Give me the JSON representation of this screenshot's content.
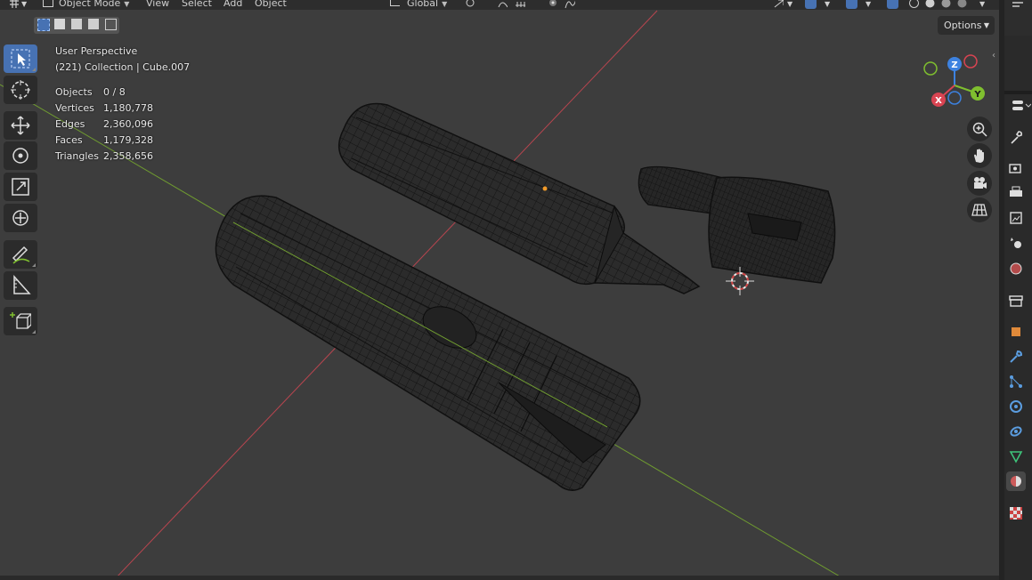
{
  "header": {
    "mode": "Object Mode",
    "menus": [
      "View",
      "Select",
      "Add",
      "Object"
    ],
    "transform_orientation": "Global"
  },
  "overlay": {
    "view_name": "User Perspective",
    "collection_info": "(221) Collection | Cube.007",
    "stats": [
      {
        "label": "Objects",
        "value": "0 / 8"
      },
      {
        "label": "Vertices",
        "value": "1,180,778"
      },
      {
        "label": "Edges",
        "value": "2,360,096"
      },
      {
        "label": "Faces",
        "value": "1,179,328"
      },
      {
        "label": "Triangles",
        "value": "2,358,656"
      }
    ]
  },
  "options_label": "Options",
  "gizmo": {
    "x": "X",
    "y": "Y",
    "z": "Z"
  },
  "colors": {
    "accent": "#4772b3",
    "x_axis": "#d94452",
    "y_axis": "#7fbf2f",
    "z_axis": "#3d82e0",
    "background": "#3d3d3d"
  },
  "toolbar_tools": [
    "select-box",
    "cursor",
    "move",
    "rotate",
    "scale",
    "transform",
    "annotate",
    "measure",
    "add-cube"
  ],
  "property_tabs": [
    "tool",
    "render",
    "output",
    "view-layer",
    "scene",
    "world",
    "collection",
    "object",
    "modifiers",
    "particles",
    "physics",
    "constraints",
    "data",
    "material",
    "texture"
  ]
}
